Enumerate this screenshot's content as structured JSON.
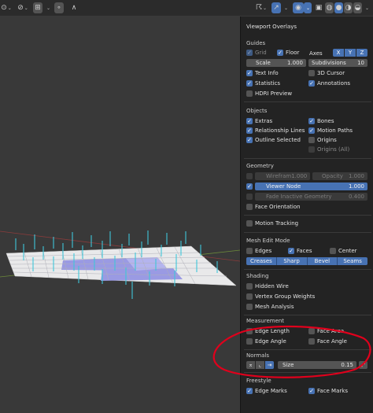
{
  "header": {
    "buttons": [
      {
        "name": "transform-pivot-icon",
        "glyph": "⊙"
      },
      {
        "name": "snap-icon",
        "glyph": "⊘"
      },
      {
        "name": "snap-grid-icon",
        "glyph": "⊞"
      },
      {
        "name": "proportional-edit-icon",
        "glyph": "∘"
      },
      {
        "name": "falloff-icon",
        "glyph": "∧"
      },
      {
        "name": "gizmo-icon",
        "glyph": "☈"
      },
      {
        "name": "xray-arrow-icon",
        "glyph": "↗"
      },
      {
        "name": "overlays-icon",
        "glyph": "◉"
      },
      {
        "name": "xray-toggle-icon",
        "glyph": "▣"
      },
      {
        "name": "wireframe-shading-icon",
        "glyph": "◍"
      },
      {
        "name": "solid-shading-icon",
        "glyph": "●"
      },
      {
        "name": "material-shading-icon",
        "glyph": "◑"
      },
      {
        "name": "rendered-shading-icon",
        "glyph": "◒"
      }
    ],
    "chevron": "⌄"
  },
  "panel": {
    "title": "Viewport Overlays",
    "guides": {
      "heading": "Guides",
      "grid": "Grid",
      "floor": "Floor",
      "axes": "Axes",
      "axis_x": "X",
      "axis_y": "Y",
      "axis_z": "Z",
      "scale_label": "Scale",
      "scale_value": "1.000",
      "subdivisions_label": "Subdivisions",
      "subdivisions_value": "10",
      "text_info": "Text Info",
      "cursor_3d": "3D Cursor",
      "statistics": "Statistics",
      "annotations": "Annotations",
      "hdri_preview": "HDRI Preview"
    },
    "objects": {
      "heading": "Objects",
      "extras": "Extras",
      "bones": "Bones",
      "relationship_lines": "Relationship Lines",
      "motion_paths": "Motion Paths",
      "outline_selected": "Outline Selected",
      "origins": "Origins",
      "origins_all": "Origins (All)"
    },
    "geometry": {
      "heading": "Geometry",
      "wireframe_label": "Wirefram",
      "wireframe_value": "1.000",
      "opacity_label": "Opacity",
      "opacity_value": "1.000",
      "viewer_node_label": "Viewer Node",
      "viewer_node_value": "1.000",
      "fade_label": "Fade Inactive Geometry",
      "fade_value": "0.400",
      "face_orientation": "Face Orientation"
    },
    "motion_tracking": "Motion Tracking",
    "mesh_edit": {
      "heading": "Mesh Edit Mode",
      "edges": "Edges",
      "faces": "Faces",
      "center": "Center",
      "creases": "Creases",
      "sharp": "Sharp",
      "bevel": "Bevel",
      "seams": "Seams"
    },
    "shading": {
      "heading": "Shading",
      "hidden_wire": "Hidden Wire",
      "vertex_group_weights": "Vertex Group Weights",
      "mesh_analysis": "Mesh Analysis"
    },
    "measurement": {
      "heading": "Measurement",
      "edge_length": "Edge Length",
      "face_area": "Face Area",
      "edge_angle": "Edge Angle",
      "face_angle": "Face Angle"
    },
    "normals": {
      "heading": "Normals",
      "size_label": "Size",
      "size_value": "0.15",
      "vertex_normals_icon": "vertex-normals-icon",
      "split_normals_icon": "split-normals-icon",
      "face_normals_icon": "face-normals-icon",
      "constant_screen_size_icon": "constant-screen-size-icon"
    },
    "freestyle": {
      "heading": "Freestyle",
      "edge_marks": "Edge Marks",
      "face_marks": "Face Marks"
    }
  },
  "colors": {
    "accent": "#4772b3",
    "panel_bg": "#232323",
    "viewport_bg": "#393939",
    "normals_line": "#3ec6d9",
    "selected_faces": "#8c8ce0",
    "annotation_circle": "#e0001c"
  }
}
